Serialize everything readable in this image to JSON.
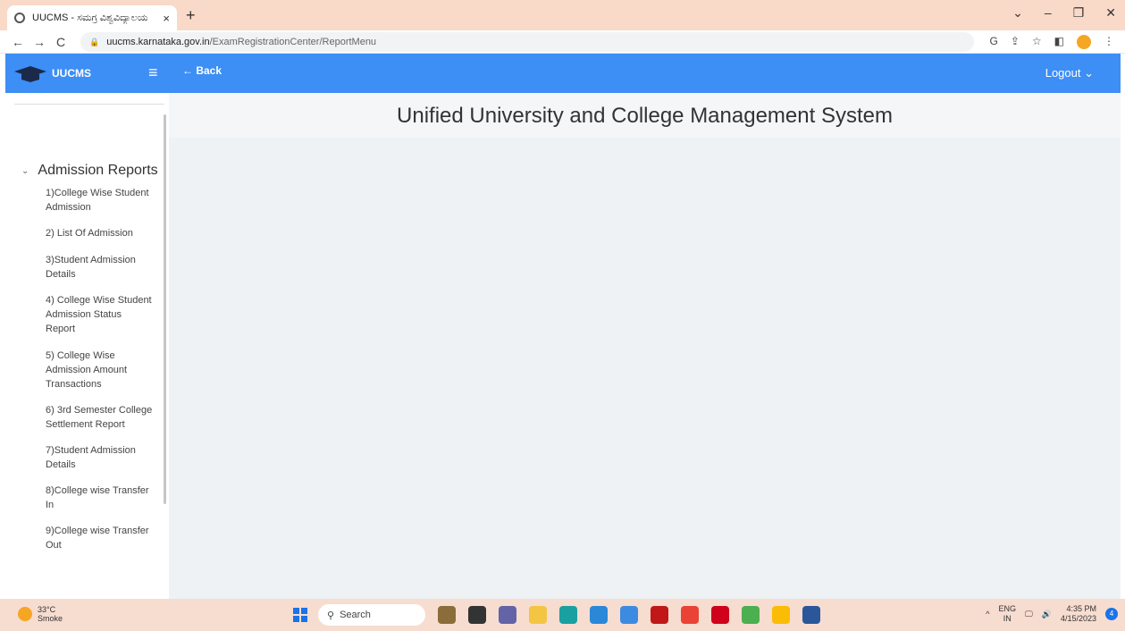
{
  "browser": {
    "tab_title": "UUCMS - ಸಮಗ್ರ ವಿಶ್ವವಿದ್ಯಾಲಯ",
    "url_host": "uucms.karnataka.gov.in",
    "url_path": "/ExamRegistrationCenter/ReportMenu"
  },
  "header": {
    "brand": "UUCMS",
    "back_label": "← Back",
    "logout_label": "Logout ⌄"
  },
  "sidebar": {
    "group_label": "Admission Reports",
    "items": [
      {
        "label": "1)College Wise Student Admission"
      },
      {
        "label": "2) List Of Admission"
      },
      {
        "label": "3)Student Admission Details"
      },
      {
        "label": "4) College Wise Student Admission Status Report"
      },
      {
        "label": "5) College Wise Admission Amount Transactions"
      },
      {
        "label": "6) 3rd Semester College Settlement Report"
      },
      {
        "label": "7)Student Admission Details"
      },
      {
        "label": "8)College wise Transfer In"
      },
      {
        "label": "9)College wise Transfer Out"
      }
    ]
  },
  "main": {
    "title": "Unified University and College Management System"
  },
  "taskbar": {
    "temperature": "33°C",
    "weather": "Smoke",
    "search_label": "Search",
    "lang_top": "ENG",
    "lang_bottom": "IN",
    "time": "4:35 PM",
    "date": "4/15/2023",
    "notif_count": "4"
  }
}
